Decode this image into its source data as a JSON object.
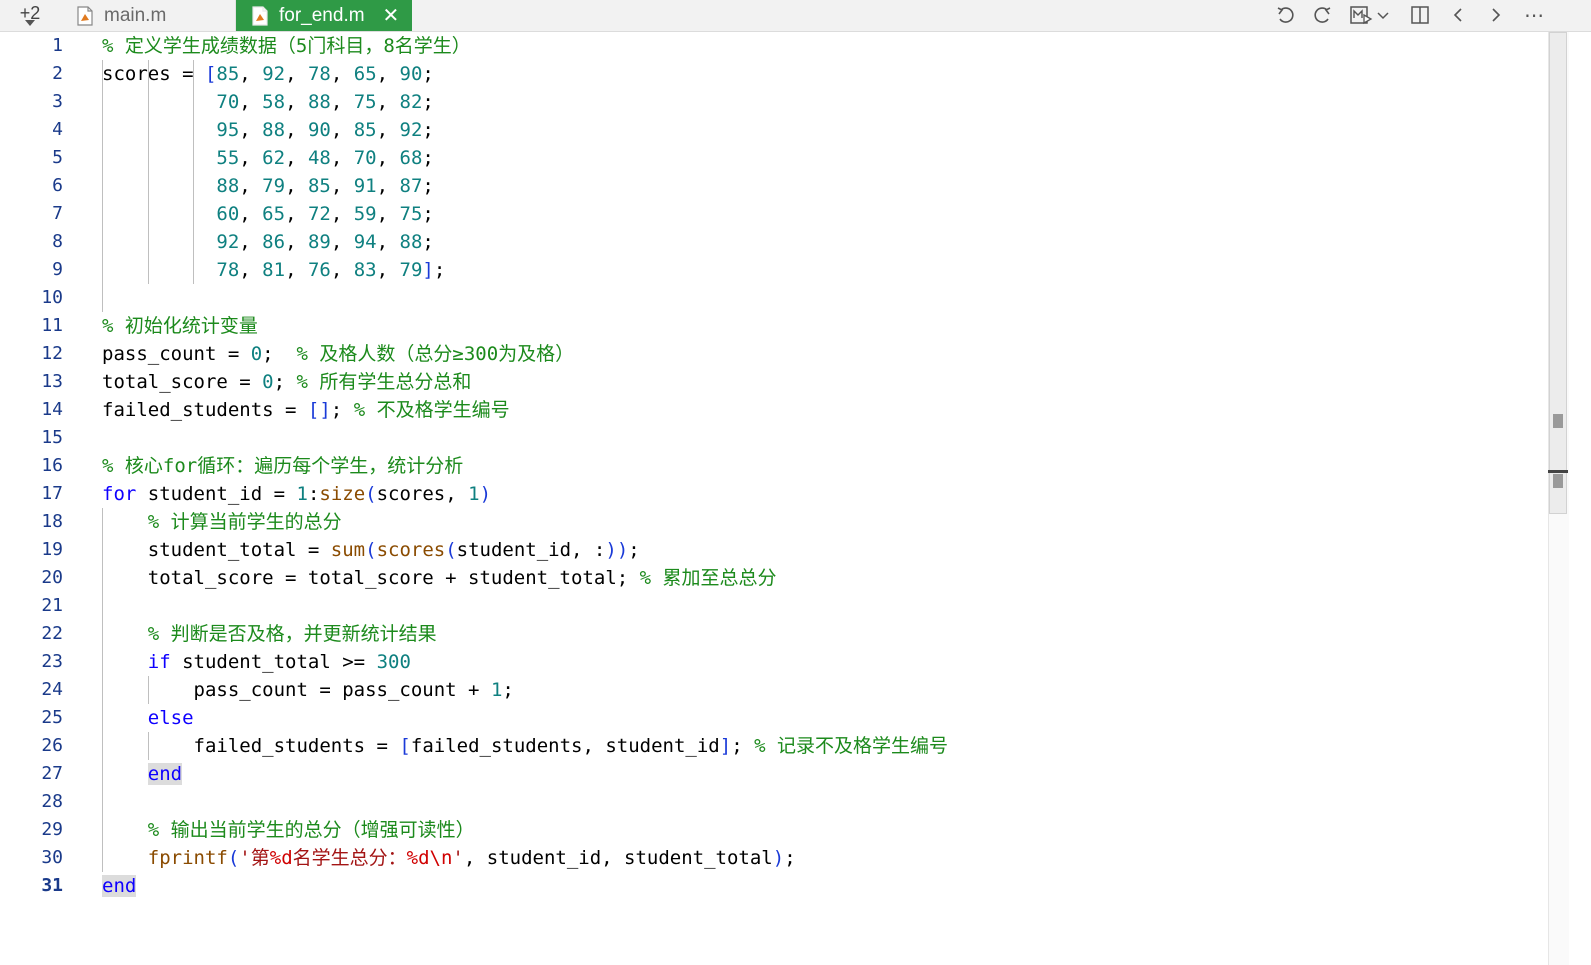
{
  "tabs": {
    "more_count": "+2",
    "items": [
      {
        "label": "main.m",
        "active": false
      },
      {
        "label": "for_end.m",
        "active": true
      }
    ],
    "close_glyph": "✕"
  },
  "toolbar": {
    "icons": [
      "undo-icon",
      "redo-icon",
      "run-section-icon",
      "chevron-down-icon",
      "split-view-icon",
      "chevron-left-icon",
      "chevron-right-icon",
      "more-icon"
    ],
    "more_glyph": "⋯"
  },
  "colors": {
    "active_tab": "#2f9a46",
    "comment": "#1c8a1c",
    "keyword": "#0e00ff",
    "number": "#0f8080",
    "string": "#a31515",
    "format_spec": "#d00000",
    "line_number": "#1a3a8a"
  },
  "editor": {
    "language": "MATLAB",
    "lines": [
      [
        {
          "t": "% 定义学生成绩数据（5门科目，8名学生）",
          "c": "cm"
        }
      ],
      [
        {
          "t": "scores = "
        },
        {
          "t": "[",
          "c": "br"
        },
        {
          "t": "85",
          "c": "num"
        },
        {
          "t": ", "
        },
        {
          "t": "92",
          "c": "num"
        },
        {
          "t": ", "
        },
        {
          "t": "78",
          "c": "num"
        },
        {
          "t": ", "
        },
        {
          "t": "65",
          "c": "num"
        },
        {
          "t": ", "
        },
        {
          "t": "90",
          "c": "num"
        },
        {
          "t": ";"
        }
      ],
      [
        {
          "t": "          "
        },
        {
          "t": "70",
          "c": "num"
        },
        {
          "t": ", "
        },
        {
          "t": "58",
          "c": "num"
        },
        {
          "t": ", "
        },
        {
          "t": "88",
          "c": "num"
        },
        {
          "t": ", "
        },
        {
          "t": "75",
          "c": "num"
        },
        {
          "t": ", "
        },
        {
          "t": "82",
          "c": "num"
        },
        {
          "t": ";"
        }
      ],
      [
        {
          "t": "          "
        },
        {
          "t": "95",
          "c": "num"
        },
        {
          "t": ", "
        },
        {
          "t": "88",
          "c": "num"
        },
        {
          "t": ", "
        },
        {
          "t": "90",
          "c": "num"
        },
        {
          "t": ", "
        },
        {
          "t": "85",
          "c": "num"
        },
        {
          "t": ", "
        },
        {
          "t": "92",
          "c": "num"
        },
        {
          "t": ";"
        }
      ],
      [
        {
          "t": "          "
        },
        {
          "t": "55",
          "c": "num"
        },
        {
          "t": ", "
        },
        {
          "t": "62",
          "c": "num"
        },
        {
          "t": ", "
        },
        {
          "t": "48",
          "c": "num"
        },
        {
          "t": ", "
        },
        {
          "t": "70",
          "c": "num"
        },
        {
          "t": ", "
        },
        {
          "t": "68",
          "c": "num"
        },
        {
          "t": ";"
        }
      ],
      [
        {
          "t": "          "
        },
        {
          "t": "88",
          "c": "num"
        },
        {
          "t": ", "
        },
        {
          "t": "79",
          "c": "num"
        },
        {
          "t": ", "
        },
        {
          "t": "85",
          "c": "num"
        },
        {
          "t": ", "
        },
        {
          "t": "91",
          "c": "num"
        },
        {
          "t": ", "
        },
        {
          "t": "87",
          "c": "num"
        },
        {
          "t": ";"
        }
      ],
      [
        {
          "t": "          "
        },
        {
          "t": "60",
          "c": "num"
        },
        {
          "t": ", "
        },
        {
          "t": "65",
          "c": "num"
        },
        {
          "t": ", "
        },
        {
          "t": "72",
          "c": "num"
        },
        {
          "t": ", "
        },
        {
          "t": "59",
          "c": "num"
        },
        {
          "t": ", "
        },
        {
          "t": "75",
          "c": "num"
        },
        {
          "t": ";"
        }
      ],
      [
        {
          "t": "          "
        },
        {
          "t": "92",
          "c": "num"
        },
        {
          "t": ", "
        },
        {
          "t": "86",
          "c": "num"
        },
        {
          "t": ", "
        },
        {
          "t": "89",
          "c": "num"
        },
        {
          "t": ", "
        },
        {
          "t": "94",
          "c": "num"
        },
        {
          "t": ", "
        },
        {
          "t": "88",
          "c": "num"
        },
        {
          "t": ";"
        }
      ],
      [
        {
          "t": "          "
        },
        {
          "t": "78",
          "c": "num"
        },
        {
          "t": ", "
        },
        {
          "t": "81",
          "c": "num"
        },
        {
          "t": ", "
        },
        {
          "t": "76",
          "c": "num"
        },
        {
          "t": ", "
        },
        {
          "t": "83",
          "c": "num"
        },
        {
          "t": ", "
        },
        {
          "t": "79",
          "c": "num"
        },
        {
          "t": "]",
          "c": "br"
        },
        {
          "t": ";"
        }
      ],
      [],
      [
        {
          "t": "% 初始化统计变量",
          "c": "cm"
        }
      ],
      [
        {
          "t": "pass_count = "
        },
        {
          "t": "0",
          "c": "num"
        },
        {
          "t": ";  "
        },
        {
          "t": "% 及格人数（总分≥300为及格）",
          "c": "cm"
        }
      ],
      [
        {
          "t": "total_score = "
        },
        {
          "t": "0",
          "c": "num"
        },
        {
          "t": "; "
        },
        {
          "t": "% 所有学生总分总和",
          "c": "cm"
        }
      ],
      [
        {
          "t": "failed_students = "
        },
        {
          "t": "[]",
          "c": "br"
        },
        {
          "t": "; "
        },
        {
          "t": "% 不及格学生编号",
          "c": "cm"
        }
      ],
      [],
      [
        {
          "t": "% 核心for循环：遍历每个学生，统计分析",
          "c": "cm"
        }
      ],
      [
        {
          "t": "for",
          "c": "kw"
        },
        {
          "t": " student_id = "
        },
        {
          "t": "1",
          "c": "num"
        },
        {
          "t": ":"
        },
        {
          "t": "size",
          "c": "fn"
        },
        {
          "t": "(",
          "c": "br"
        },
        {
          "t": "scores, "
        },
        {
          "t": "1",
          "c": "num"
        },
        {
          "t": ")",
          "c": "br"
        }
      ],
      [
        {
          "t": "    "
        },
        {
          "t": "% 计算当前学生的总分",
          "c": "cm"
        }
      ],
      [
        {
          "t": "    student_total = "
        },
        {
          "t": "sum",
          "c": "fn"
        },
        {
          "t": "(",
          "c": "br"
        },
        {
          "t": "scores",
          "c": "fn"
        },
        {
          "t": "(",
          "c": "br"
        },
        {
          "t": "student_id, :"
        },
        {
          "t": "))",
          "c": "br"
        },
        {
          "t": ";"
        }
      ],
      [
        {
          "t": "    total_score = total_score + student_total; "
        },
        {
          "t": "% 累加至总总分",
          "c": "cm"
        }
      ],
      [],
      [
        {
          "t": "    "
        },
        {
          "t": "% 判断是否及格，并更新统计结果",
          "c": "cm"
        }
      ],
      [
        {
          "t": "    "
        },
        {
          "t": "if",
          "c": "kw"
        },
        {
          "t": " student_total >= "
        },
        {
          "t": "300",
          "c": "num"
        }
      ],
      [
        {
          "t": "        pass_count = pass_count + "
        },
        {
          "t": "1",
          "c": "num"
        },
        {
          "t": ";"
        }
      ],
      [
        {
          "t": "    "
        },
        {
          "t": "else",
          "c": "kw"
        }
      ],
      [
        {
          "t": "        failed_students = "
        },
        {
          "t": "[",
          "c": "br"
        },
        {
          "t": "failed_students, student_id"
        },
        {
          "t": "]",
          "c": "br"
        },
        {
          "t": "; "
        },
        {
          "t": "% 记录不及格学生编号",
          "c": "cm"
        }
      ],
      [
        {
          "t": "    "
        },
        {
          "t": "end",
          "c": "kw hl"
        }
      ],
      [],
      [
        {
          "t": "    "
        },
        {
          "t": "% 输出当前学生的总分（增强可读性）",
          "c": "cm"
        }
      ],
      [
        {
          "t": "    "
        },
        {
          "t": "fprintf",
          "c": "fn"
        },
        {
          "t": "(",
          "c": "br"
        },
        {
          "t": "'第",
          "c": "str"
        },
        {
          "t": "%d",
          "c": "fmt"
        },
        {
          "t": "名学生总分：",
          "c": "str"
        },
        {
          "t": "%d\\n",
          "c": "fmt"
        },
        {
          "t": "'",
          "c": "str"
        },
        {
          "t": ", student_id, student_total"
        },
        {
          "t": ")",
          "c": "br"
        },
        {
          "t": ";"
        }
      ],
      [
        {
          "t": "end",
          "c": "kw hl"
        }
      ]
    ]
  }
}
